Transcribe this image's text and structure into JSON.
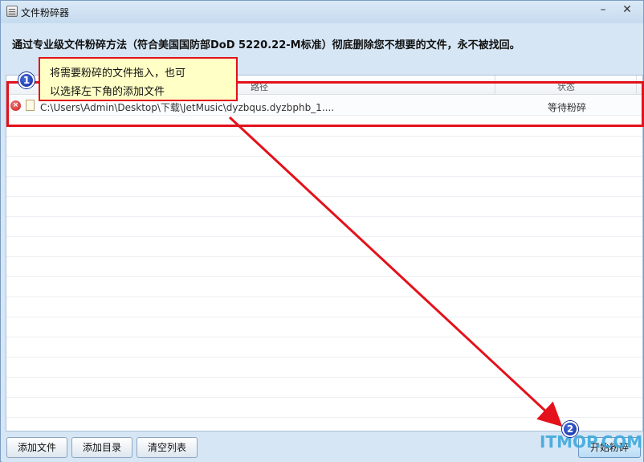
{
  "window": {
    "title": "文件粉碎器",
    "minimize_glyph": "–",
    "close_glyph": "✕"
  },
  "header": {
    "description": "通过专业级文件粉碎方法（符合美国国防部DoD 5220.22-M标准）彻底删除您不想要的文件，永不被找回。"
  },
  "list": {
    "columns": {
      "path": "路径",
      "status": "状态"
    },
    "rows": [
      {
        "path": "C:\\Users\\Admin\\Desktop\\下载\\JetMusic\\dyzbqus.dyzbphb_1....",
        "status": "等待粉碎",
        "delete_glyph": "×"
      }
    ]
  },
  "annotation": {
    "line1": "将需要粉碎的文件拖入，也可",
    "line2": "以选择左下角的添加文件",
    "badge1": "1",
    "badge2": "2",
    "color": "#e3121b"
  },
  "footer": {
    "add_file": "添加文件",
    "add_dir": "添加目录",
    "clear_list": "清空列表",
    "start": "开始粉碎"
  },
  "watermark": "ITMOP.COM",
  "icons": [
    "app-icon",
    "minimize-icon",
    "close-icon",
    "delete-icon",
    "file-icon"
  ]
}
